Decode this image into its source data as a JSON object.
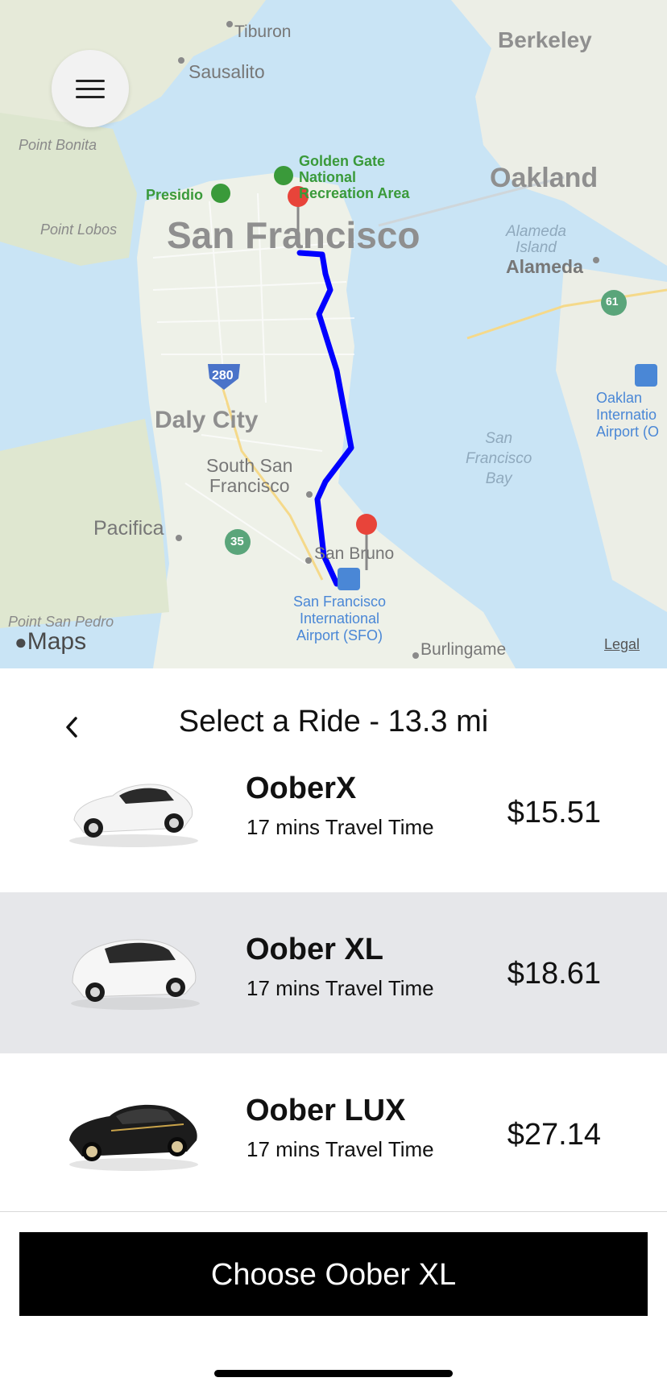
{
  "map": {
    "labels": {
      "tiburon": "Tiburon",
      "berkeley": "Berkeley",
      "sausalito": "Sausalito",
      "point_bonita": "Point Bonita",
      "golden_gate": "Golden Gate\nNational\nRecreation Area",
      "presidio": "Presidio",
      "oakland": "Oakland",
      "point_lobos": "Point Lobos",
      "san_francisco": "San Francisco",
      "alameda_island": "Alameda\nIsland",
      "alameda": "Alameda",
      "highway_61": "61",
      "highway_280": "280",
      "highway_35": "35",
      "oakland_airport": "Oaklan\nInternatio\nAirport (O",
      "daly_city": "Daly City",
      "sf_bay": "San\nFrancisco\nBay",
      "south_sf": "South San\nFrancisco",
      "pacifica": "Pacifica",
      "san_bruno": "San Bruno",
      "sfo": "San Francisco\nInternational\nAirport (SFO)",
      "point_san_pedro": "Point San Pedro",
      "burlingame": "Burlingame",
      "legal": "Legal",
      "maps_brand": "Maps"
    },
    "colors": {
      "water": "#c9e4f5",
      "land": "#eef1e8",
      "route": "#0000ff",
      "pin": "#e8443a"
    }
  },
  "menu": {
    "icon": "hamburger-menu-icon"
  },
  "header": {
    "back_icon": "chevron-left-icon",
    "title": "Select a Ride - 13.3 mi"
  },
  "rides": [
    {
      "name": "OoberX",
      "time": "17 mins Travel Time",
      "price": "$15.51",
      "icon": "sedan-white-icon",
      "selected": false
    },
    {
      "name": "Oober XL",
      "time": "17 mins Travel Time",
      "price": "$18.61",
      "icon": "minivan-white-icon",
      "selected": true
    },
    {
      "name": "Oober LUX",
      "time": "17 mins Travel Time",
      "price": "$27.14",
      "icon": "sedan-black-icon",
      "selected": false
    }
  ],
  "action": {
    "label": "Choose Oober XL"
  }
}
